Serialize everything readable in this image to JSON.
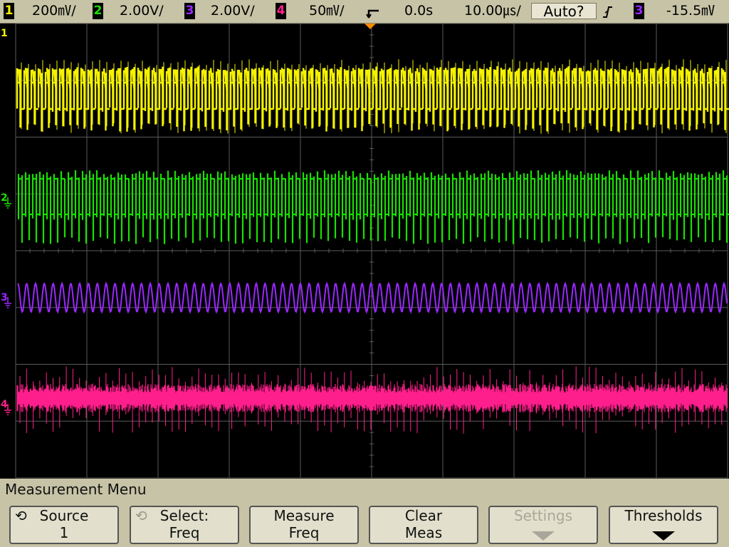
{
  "status_bar": {
    "ch1": {
      "num": "1",
      "scale": "200㎷/"
    },
    "ch2": {
      "num": "2",
      "scale": "2.00V/"
    },
    "ch3": {
      "num": "3",
      "scale": "2.00V/"
    },
    "ch4": {
      "num": "4",
      "scale": "50㎷/"
    },
    "delay": "0.0s",
    "timebase": "10.00㎲/",
    "run_mode": "Auto?",
    "trigger": {
      "source_num": "3",
      "level": "-15.5㎷"
    }
  },
  "markers": {
    "ch1": "1",
    "ch2": "2",
    "ch3": "3",
    "ch4": "4"
  },
  "colors": {
    "ch1": "#f4f200",
    "ch2": "#19e000",
    "ch3": "#9a28ff",
    "ch4": "#ff1f8c",
    "trigger": "#ff8a00",
    "grid": "#5a5a5a"
  },
  "menu": {
    "title": "Measurement Menu",
    "softkeys": [
      {
        "line1": "Source",
        "line2": "1",
        "enabled": true
      },
      {
        "line1": "Select:",
        "line2": "Freq",
        "enabled": false
      },
      {
        "line1": "Measure",
        "line2": "Freq",
        "enabled": true
      },
      {
        "line1": "Clear",
        "line2": "Meas",
        "enabled": true
      },
      {
        "line1": "Settings",
        "line2": "",
        "enabled": false
      },
      {
        "line1": "Thresholds",
        "line2": "",
        "enabled": true
      }
    ]
  }
}
